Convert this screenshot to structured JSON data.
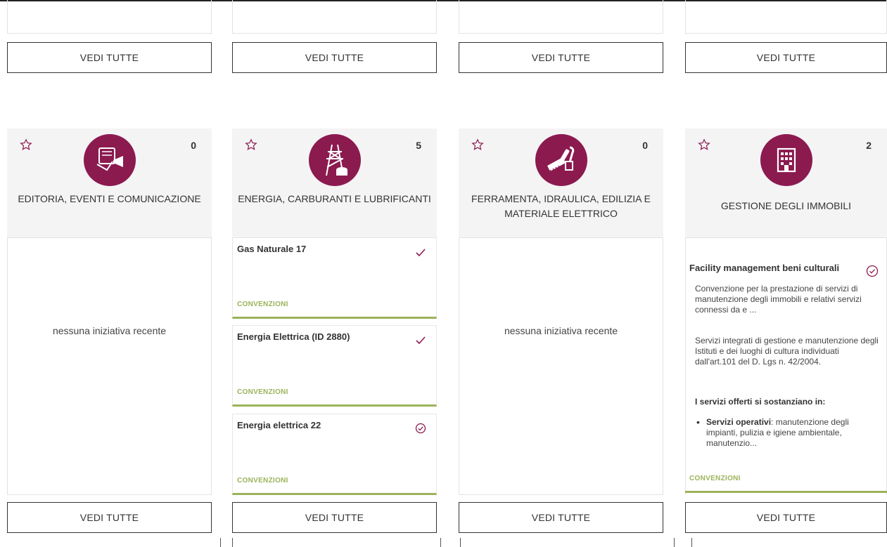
{
  "buttons": {
    "see_all": "VEDI TUTTE"
  },
  "categories": [
    {
      "title": "EDITORIA, EVENTI E COMUNICAZIONE",
      "count": "0",
      "empty": "nessuna iniziativa recente",
      "icon": "megaphone-events-icon"
    },
    {
      "title": "ENERGIA, CARBURANTI E LUBRIFICANTI",
      "count": "5",
      "icon": "power-pylon-icon",
      "initiatives": [
        {
          "title": "Gas Naturale 17",
          "tag": "CONVENZIONI"
        },
        {
          "title": "Energia Elettrica (ID 2880)",
          "tag": "CONVENZIONI"
        },
        {
          "title": "Energia elettrica 22",
          "tag": "CONVENZIONI"
        }
      ]
    },
    {
      "title": "FERRAMENTA, IDRAULICA, EDILIZIA E MATERIALE ELETTRICO",
      "count": "0",
      "empty": "nessuna iniziativa recente",
      "icon": "tools-icon"
    },
    {
      "title": "GESTIONE DEGLI IMMOBILI",
      "count": "2",
      "icon": "building-icon",
      "detail": {
        "title": "Facility management beni culturali",
        "p1": "Convenzione per la prestazione di servizi di manutenzione degli immobili e relativi servizi connessi da e ...",
        "p2": "Servizi integrati di gestione e manutenzione degli Istituti e dei luoghi di cultura individuati dall'art.101 del D. Lgs n. 42/2004.",
        "subtitle": "I servizi offerti si sostanziano in:",
        "bullet_bold": "Servizi operativi",
        "bullet_text": ": manutenzione degli impianti, pulizia e igiene ambientale, manutenzio...",
        "tag": "CONVENZIONI"
      }
    }
  ],
  "colors": {
    "accent": "#8b1a4f",
    "green": "#9bb35a"
  }
}
